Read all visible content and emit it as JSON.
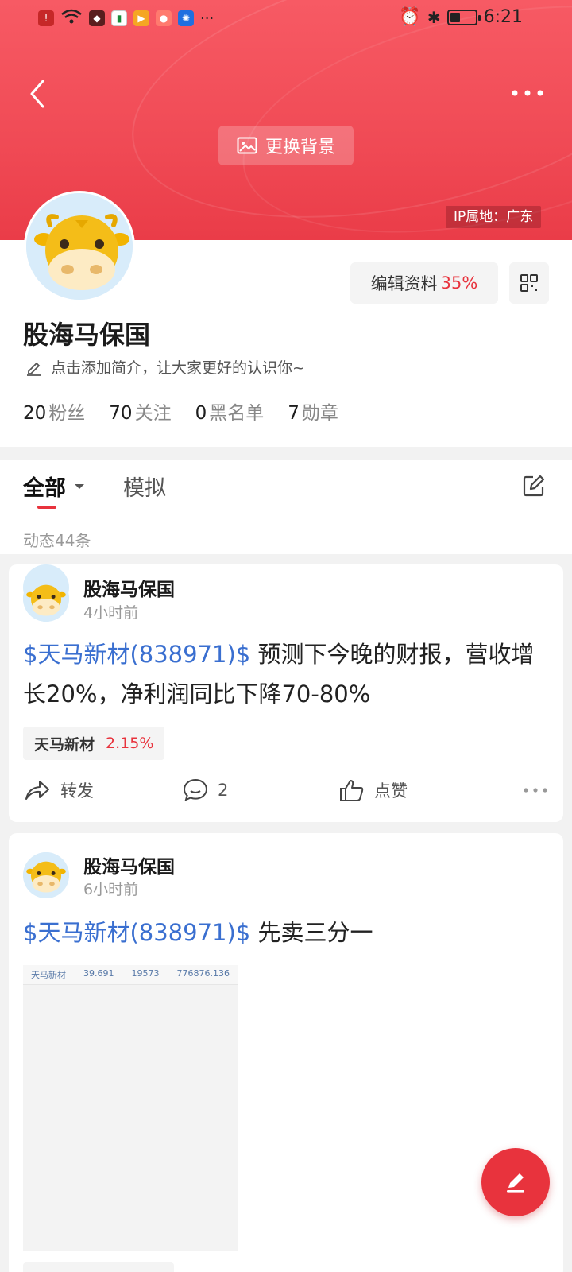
{
  "status_bar": {
    "time": "6:21"
  },
  "header": {
    "change_background": "更换背景",
    "ip_location": "IP属地：广东"
  },
  "profile": {
    "edit_label": "编辑资料",
    "edit_percent": "35%",
    "name": "股海马保国",
    "bio_placeholder": "点击添加简介，让大家更好的认识你~",
    "stats": [
      {
        "num": "20",
        "label": "粉丝"
      },
      {
        "num": "70",
        "label": "关注"
      },
      {
        "num": "0",
        "label": "黑名单"
      },
      {
        "num": "7",
        "label": "勋章"
      }
    ]
  },
  "tabs": {
    "all": "全部",
    "simulation": "模拟"
  },
  "post_count": "动态44条",
  "posts": [
    {
      "author": "股海马保国",
      "time": "4小时前",
      "stock": "$天马新材(838971)$",
      "text": " 预测下今晚的财报，营收增长20%，净利润同比下降70-80%",
      "tag_name": "天马新材",
      "tag_change": "2.15%",
      "repost": "转发",
      "comments": "2",
      "like": "点赞"
    },
    {
      "author": "股海马保国",
      "time": "6小时前",
      "stock": "$天马新材(838971)$",
      "text": " 先卖三分一",
      "image_row": [
        "天马新材",
        "39.691",
        "19573",
        "776876.136"
      ]
    }
  ],
  "colors": {
    "accent": "#e8333d",
    "stock_link": "#3a6fd0",
    "header_red": "#f04a55"
  }
}
